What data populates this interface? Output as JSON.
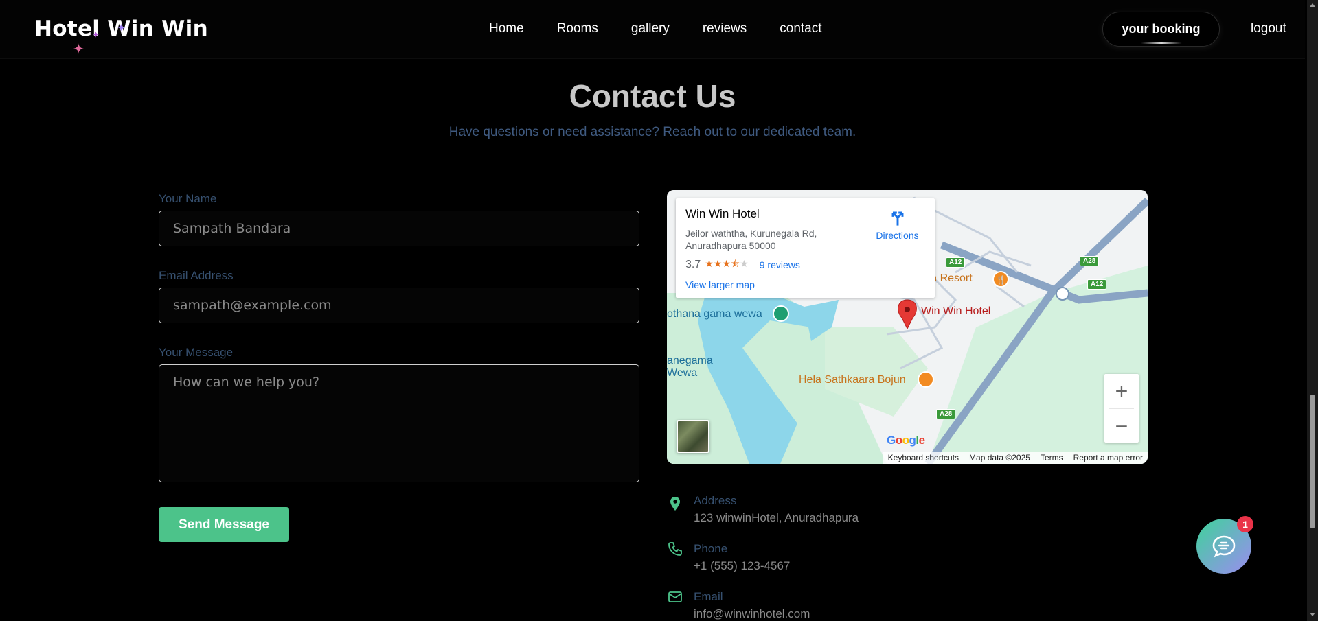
{
  "nav": {
    "brand": "Hotel Win Win",
    "links": [
      "Home",
      "Rooms",
      "gallery",
      "reviews",
      "contact"
    ],
    "booking_label": "your booking",
    "logout_label": "logout"
  },
  "header": {
    "title": "Contact Us",
    "subtitle": "Have questions or need assistance? Reach out to our dedicated team."
  },
  "form": {
    "name_label": "Your Name",
    "name_value": "Sampath Bandara",
    "email_label": "Email Address",
    "email_placeholder": "sampath@example.com",
    "message_label": "Your Message",
    "message_placeholder": "How can we help you?",
    "send_label": "Send Message"
  },
  "map": {
    "place_name": "Win Win Hotel",
    "address": "Jeilor waththa, Kurunegala Rd, Anuradhapura 50000",
    "rating": "3.7",
    "rating_value": 3.7,
    "reviews": "9 reviews",
    "larger_map": "View larger map",
    "directions": "Directions",
    "labels": {
      "resort": "ura Resort",
      "hotel_pin": "Win Win Hotel",
      "wewa1": "othana gama wewa",
      "wewa2a": "anegama",
      "wewa2b": "Wewa",
      "bojun": "Hela Sathkaara Bojun"
    },
    "roads": [
      "A12",
      "A28",
      "A12",
      "A28"
    ],
    "footer": [
      "Keyboard shortcuts",
      "Map data ©2025",
      "Terms",
      "Report a map error"
    ],
    "google": "Google",
    "zoom_in": "+",
    "zoom_out": "−"
  },
  "contact": {
    "address_label": "Address",
    "address_value": "123 winwinHotel, Anuradhapura",
    "phone_label": "Phone",
    "phone_value": "+1 (555) 123-4567",
    "email_label": "Email",
    "email_value": "info@winwinhotel.com"
  },
  "chat": {
    "badge": "1"
  },
  "colors": {
    "accent": "#4cc38a",
    "label": "#36506f",
    "title": "#c8c8c8",
    "badge": "#ea3349"
  }
}
